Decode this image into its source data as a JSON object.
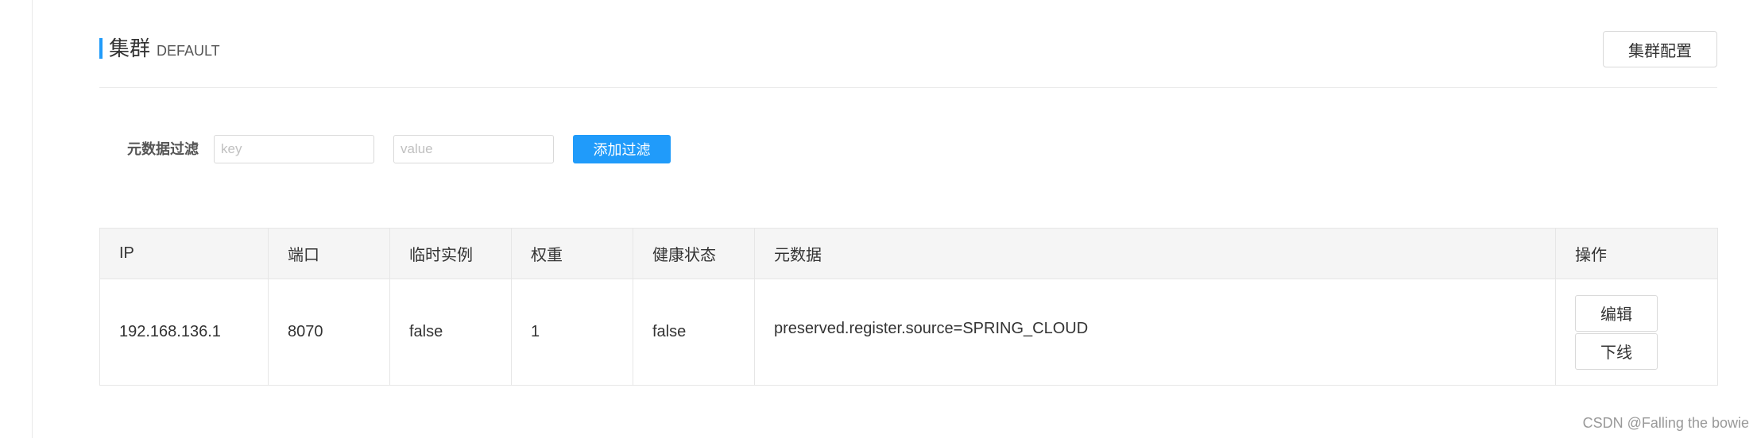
{
  "cluster": {
    "title": "集群",
    "name": "DEFAULT",
    "config_button": "集群配置"
  },
  "filter": {
    "label": "元数据过滤",
    "key_placeholder": "key",
    "value_placeholder": "value",
    "key_value": "",
    "value_value": "",
    "add_button": "添加过滤"
  },
  "table": {
    "headers": {
      "ip": "IP",
      "port": "端口",
      "ephemeral": "临时实例",
      "weight": "权重",
      "healthy": "健康状态",
      "metadata": "元数据",
      "operations": "操作"
    },
    "rows": [
      {
        "ip": "192.168.136.1",
        "port": "8070",
        "ephemeral": "false",
        "weight": "1",
        "healthy": "false",
        "metadata": "preserved.register.source=SPRING_CLOUD",
        "edit_button": "编辑",
        "offline_button": "下线"
      }
    ]
  },
  "watermark": "CSDN @Falling the bowie",
  "colors": {
    "accent": "#209bfa",
    "header_bg": "#f5f5f5",
    "border": "#e6e6e6"
  }
}
